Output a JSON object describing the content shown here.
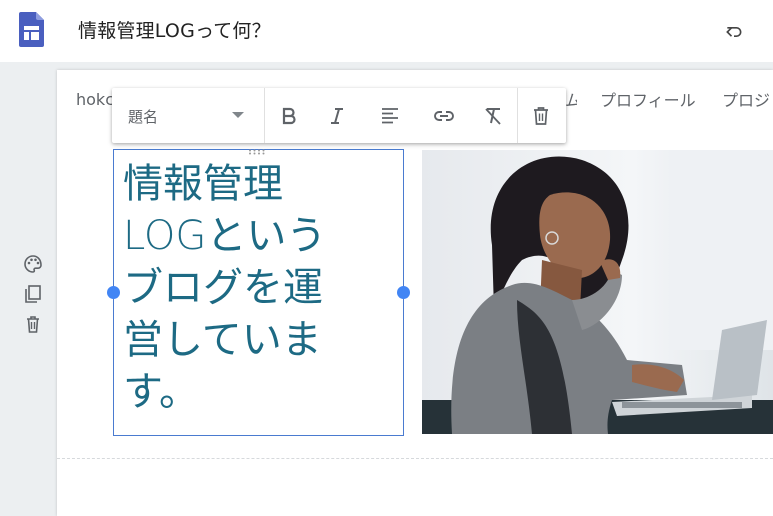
{
  "header": {
    "doc_title": "情報管理LOGって何？",
    "logo_icon": "google-sites-icon",
    "undo_icon": "undo-icon"
  },
  "site": {
    "name": "hokc",
    "nav": [
      "ム",
      "プロフィール",
      "プロジ"
    ]
  },
  "toolbar": {
    "style_value": "題名",
    "buttons": [
      "bold-icon",
      "italic-icon",
      "align-left-icon",
      "link-icon",
      "clear-format-icon",
      "delete-icon"
    ]
  },
  "side_tools": [
    "palette-icon",
    "duplicate-icon",
    "delete-icon"
  ],
  "textbox": {
    "lines": [
      "情報管理",
      "LOGという",
      "ブログを運",
      "営していま",
      "す。"
    ]
  },
  "colors": {
    "accent": "#4285f4",
    "text_teal": "#1d6a84",
    "workspace_bg": "#eceff1"
  }
}
